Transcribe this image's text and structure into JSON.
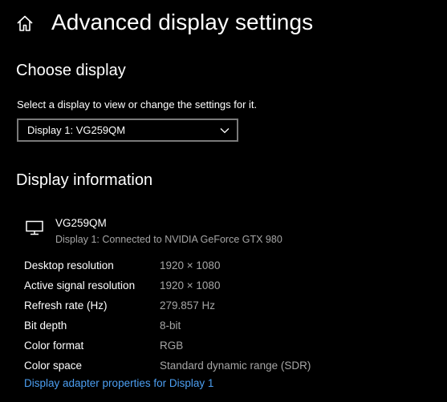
{
  "header": {
    "title": "Advanced display settings",
    "home_icon": "home-icon"
  },
  "choose_display": {
    "title": "Choose display",
    "description": "Select a display to view or change the settings for it.",
    "dropdown_value": "Display 1: VG259QM"
  },
  "display_information": {
    "title": "Display information",
    "monitor_name": "VG259QM",
    "monitor_connection": "Display 1: Connected to NVIDIA GeForce GTX 980",
    "rows": [
      {
        "label": "Desktop resolution",
        "value": "1920 × 1080"
      },
      {
        "label": "Active signal resolution",
        "value": "1920 × 1080"
      },
      {
        "label": "Refresh rate (Hz)",
        "value": "279.857 Hz"
      },
      {
        "label": "Bit depth",
        "value": "8-bit"
      },
      {
        "label": "Color format",
        "value": "RGB"
      },
      {
        "label": "Color space",
        "value": "Standard dynamic range (SDR)"
      }
    ],
    "adapter_link": "Display adapter properties for Display 1"
  },
  "colors": {
    "background": "#000000",
    "text": "#ffffff",
    "secondary_text": "#a6a6a6",
    "link": "#4c9ff2",
    "dropdown_border": "#7a7a7a"
  }
}
